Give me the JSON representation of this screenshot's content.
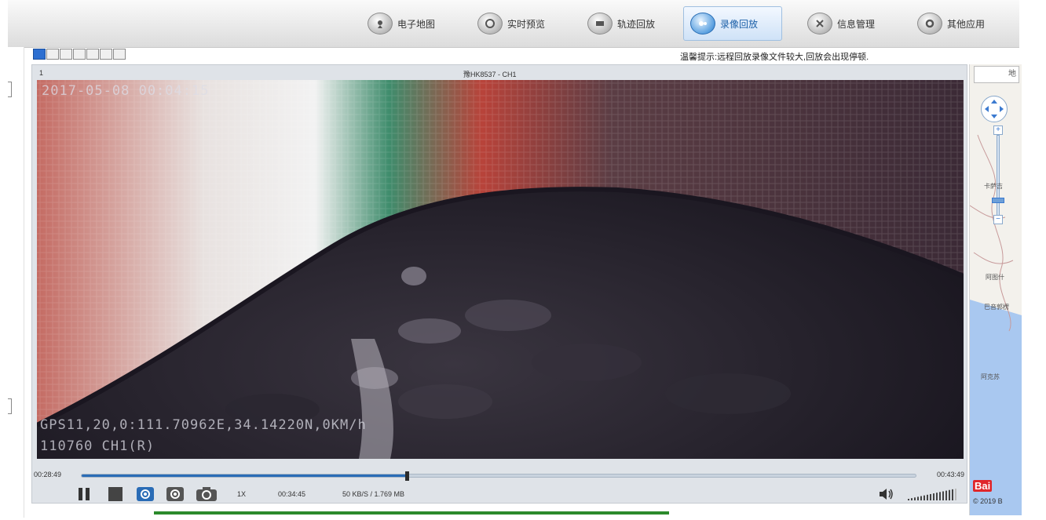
{
  "nav": {
    "items": [
      {
        "label": "电子地图",
        "icon": "map-icon"
      },
      {
        "label": "实时预览",
        "icon": "live-preview-icon"
      },
      {
        "label": "轨迹回放",
        "icon": "track-playback-icon"
      },
      {
        "label": "录像回放",
        "icon": "video-playback-icon",
        "active": true
      },
      {
        "label": "信息管理",
        "icon": "info-manage-icon"
      },
      {
        "label": "其他应用",
        "icon": "other-apps-icon"
      }
    ]
  },
  "toolbar": {
    "layouts": [
      "1-split",
      "2-split",
      "4-split",
      "6-split",
      "8-split",
      "9-split",
      "16-split"
    ],
    "tip": "温馨提示:远程回放录像文件较大,回放会出现停顿."
  },
  "player": {
    "channel_index": "1",
    "channel_name": "豫HK8537 - CH1",
    "osd_timestamp": "2017-05-08 00:04:15",
    "osd_gps": "GPS11,20,0:111.70962E,34.14220N,0KM/h",
    "osd_device": "110760   CH1(R)",
    "start_time": "00:28:49",
    "end_time": "00:43:49",
    "progress": 0.39,
    "speed": "1X",
    "current_time": "00:34:45",
    "rate": "50 KB/S / 1.769 MB",
    "volume_level": 0.9
  },
  "map": {
    "search_text": "地",
    "labels": [
      "卡萨吉",
      "阿图什",
      "巴音郭楞",
      "阿克苏"
    ],
    "logo": "Bai",
    "copyright": "© 2019 B"
  },
  "colors": {
    "accent": "#2a6cb6",
    "active_nav": "#1a5fa8",
    "progress_bar": "#2b8a2b"
  }
}
